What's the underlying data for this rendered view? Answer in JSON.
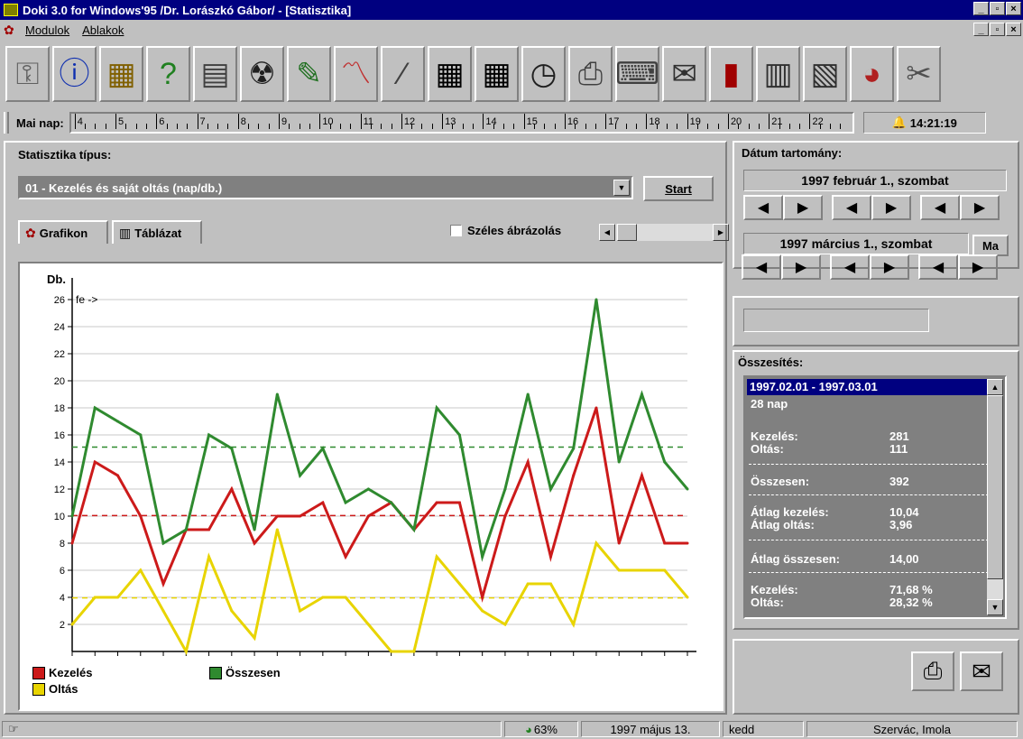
{
  "window": {
    "title": "Doki 3.0 for Windows'95 /Dr. Lorászkó Gábor/  - [Statisztika]",
    "caption_buttons": [
      "_",
      "▫",
      "×"
    ]
  },
  "menu": {
    "items": [
      "Modulok",
      "Ablakok"
    ]
  },
  "toolbar": {
    "buttons": [
      "key-icon",
      "info-icon",
      "calendar-icon",
      "help-icon",
      "documents-icon",
      "radiation-icon",
      "pencil-icon",
      "chart-icon",
      "syringe-icon",
      "grid-icon",
      "grid-icon",
      "stopwatch-icon",
      "printer-icon",
      "typewriter-icon",
      "notes-icon",
      "book-icon",
      "calculator-icon",
      "forms-icon",
      "pie-chart-icon",
      "tools-icon"
    ]
  },
  "daystrip": {
    "label": "Mai nap:",
    "hours": [
      "4",
      "5",
      "6",
      "7",
      "8",
      "9",
      "10",
      "11",
      "12",
      "13",
      "14",
      "15",
      "16",
      "17",
      "18",
      "19",
      "20",
      "21",
      "22"
    ],
    "clock": "14:21:19"
  },
  "stats": {
    "type_label": "Statisztika típus:",
    "selected_type": "01 - Kezelés és saját oltás (nap/db.)",
    "start_label": "Start",
    "tabs": [
      "Grafikon",
      "Táblázat"
    ],
    "wide_label": "Széles ábrázolás"
  },
  "date_range": {
    "label": "Dátum tartomány:",
    "from": "1997 február 1., szombat",
    "to": "1997 március 1., szombat",
    "today_button": "Ma"
  },
  "summary": {
    "label": "Összesítés:",
    "period": "1997.02.01 - 1997.03.01",
    "days": "28 nap",
    "rows": [
      {
        "label": "Kezelés:",
        "value": "281"
      },
      {
        "label": "Oltás:",
        "value": "111"
      },
      {
        "label": "Összesen:",
        "value": "392"
      },
      {
        "label": "Átlag kezelés:",
        "value": "10,04"
      },
      {
        "label": "Átlag oltás:",
        "value": "3,96"
      },
      {
        "label": "Átlag összesen:",
        "value": "14,00"
      },
      {
        "label": "Kezelés:",
        "value": "71,68 %"
      },
      {
        "label": "Oltás:",
        "value": "28,32 %"
      }
    ]
  },
  "statusbar": {
    "percent": "63%",
    "date": "1997 május 13.",
    "weekday": "kedd",
    "names": "Szervác, Imola"
  },
  "colors": {
    "kezeles": "#cc1a1a",
    "oltas": "#e8d400",
    "osszesen": "#2f8a2f",
    "titlebar": "#000080",
    "face": "#c0c0c0"
  },
  "chart_data": {
    "type": "line",
    "ylabel": "Db.",
    "annotation": "fe ->",
    "ylim": [
      0,
      26
    ],
    "yticks": [
      2,
      4,
      6,
      8,
      10,
      12,
      14,
      16,
      18,
      20,
      22,
      24,
      26
    ],
    "x": [
      1,
      2,
      3,
      4,
      5,
      6,
      7,
      8,
      9,
      10,
      11,
      12,
      13,
      14,
      15,
      16,
      17,
      18,
      19,
      20,
      21,
      22,
      23,
      24,
      25,
      26,
      27,
      28,
      29
    ],
    "series": [
      {
        "name": "Kezelés",
        "color": "#cc1a1a",
        "average": 10.04,
        "values": [
          8,
          14,
          13,
          10,
          5,
          9,
          9,
          12,
          8,
          10,
          10,
          11,
          7,
          10,
          11,
          9,
          11,
          11,
          4,
          10,
          14,
          7,
          13,
          18,
          8,
          13,
          8,
          8
        ]
      },
      {
        "name": "Oltás",
        "color": "#e8d400",
        "average": 3.96,
        "values": [
          2,
          4,
          4,
          6,
          3,
          0,
          7,
          3,
          1,
          9,
          3,
          4,
          4,
          2,
          0,
          0,
          7,
          5,
          3,
          2,
          5,
          5,
          2,
          8,
          6,
          6,
          6,
          4
        ]
      },
      {
        "name": "Összesen",
        "color": "#2f8a2f",
        "average": 15.1,
        "values": [
          10,
          18,
          17,
          16,
          8,
          9,
          16,
          15,
          9,
          19,
          13,
          15,
          11,
          12,
          11,
          9,
          18,
          16,
          7,
          12,
          19,
          12,
          15,
          26,
          14,
          19,
          14,
          12
        ]
      }
    ],
    "legend_position": "bottom-left",
    "grid": true
  }
}
